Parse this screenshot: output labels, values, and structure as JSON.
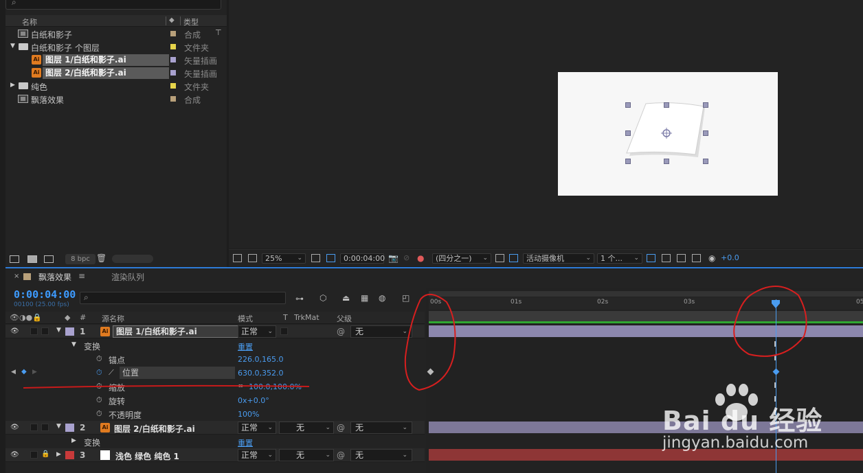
{
  "project": {
    "header": {
      "name": "名称",
      "type": "类型"
    },
    "items": [
      {
        "name": "白纸和影子",
        "type": "合成",
        "color": "#b8a07a"
      },
      {
        "name": "白纸和影子 个图层",
        "type": "文件夹",
        "color": "#e6d44a"
      },
      {
        "name": "图层 1/白纸和影子.ai",
        "type": "矢量插画",
        "color": "#a9a2cf"
      },
      {
        "name": "图层 2/白纸和影子.ai",
        "type": "矢量插画",
        "color": "#a9a2cf"
      },
      {
        "name": "纯色",
        "type": "文件夹",
        "color": "#e6d44a"
      },
      {
        "name": "飘落效果",
        "type": "合成",
        "color": "#b8a07a"
      }
    ],
    "bpc": "8 bpc"
  },
  "viewer": {
    "zoom": "25%",
    "timecode": "0:00:04:00",
    "resolution": "(四分之一)",
    "camera": "活动摄像机",
    "views": "1 个...",
    "exposure": "+0.0"
  },
  "timeline": {
    "tab_comp": "飘落效果",
    "tab_render": "渲染队列",
    "current_time": "0:00:04:00",
    "fps_info": "00100 (25.00 fps)",
    "headers": {
      "num": "#",
      "source": "源名称",
      "mode": "模式",
      "t": "T",
      "trkmat": "TrkMat",
      "parent": "父级"
    },
    "ruler": [
      "00s",
      "01s",
      "02s",
      "03s",
      "05"
    ],
    "layers": [
      {
        "num": "1",
        "name": "图层 1/白纸和影子.ai",
        "mode": "正常",
        "trkmat": "",
        "parent": "无",
        "color": "#a9a2cf"
      },
      {
        "num": "2",
        "name": "图层 2/白纸和影子.ai",
        "mode": "正常",
        "trkmat": "无",
        "parent": "无",
        "color": "#a9a2cf"
      },
      {
        "num": "3",
        "name": "浅色 绿色 纯色 1",
        "mode": "正常",
        "trkmat": "无",
        "parent": "无",
        "color": "#c83a3a"
      }
    ],
    "transform": {
      "label": "变换",
      "reset": "重置",
      "props": [
        {
          "name": "锚点",
          "value": "226.0,165.0"
        },
        {
          "name": "位置",
          "value": "630.0,352.0"
        },
        {
          "name": "缩放",
          "value": "100.0,100.0%"
        },
        {
          "name": "旋转",
          "value": "0x+0.0°"
        },
        {
          "name": "不透明度",
          "value": "100%"
        }
      ]
    },
    "layer2_transform": "变换",
    "layer2_reset": "重置"
  },
  "watermark": {
    "logo": "Bai du 经验",
    "url": "jingyan.baidu.com"
  }
}
